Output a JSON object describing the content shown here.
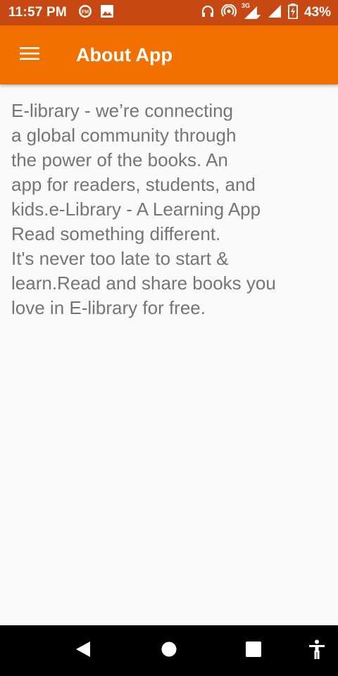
{
  "status_bar": {
    "time": "11:57 PM",
    "network_type": "3G",
    "battery_percent": "43%",
    "left_icons": [
      "fm-icon",
      "image-icon"
    ],
    "right_icons": [
      "headphones-icon",
      "hotspot-icon",
      "signal-3g-icon",
      "signal-icon",
      "battery-charging-icon"
    ]
  },
  "app_bar": {
    "title": "About App",
    "menu_icon": "hamburger-menu-icon"
  },
  "content": {
    "lines": [
      "E-library - we’re connecting",
      "a global community through",
      "the power of the books. An",
      "app for readers, students, and",
      "kids.e-Library - A Learning App",
      "Read something different.",
      "It's never too late to start &",
      "learn.Read and share books you",
      "love in E-library for free."
    ]
  },
  "nav_bar": {
    "icons": [
      "back-icon",
      "home-icon",
      "recents-icon",
      "accessibility-icon"
    ]
  },
  "colors": {
    "status_bar": "#c74812",
    "app_bar": "#f27000",
    "background": "#fafafa",
    "text": "#757575",
    "nav_bar": "#000000"
  }
}
